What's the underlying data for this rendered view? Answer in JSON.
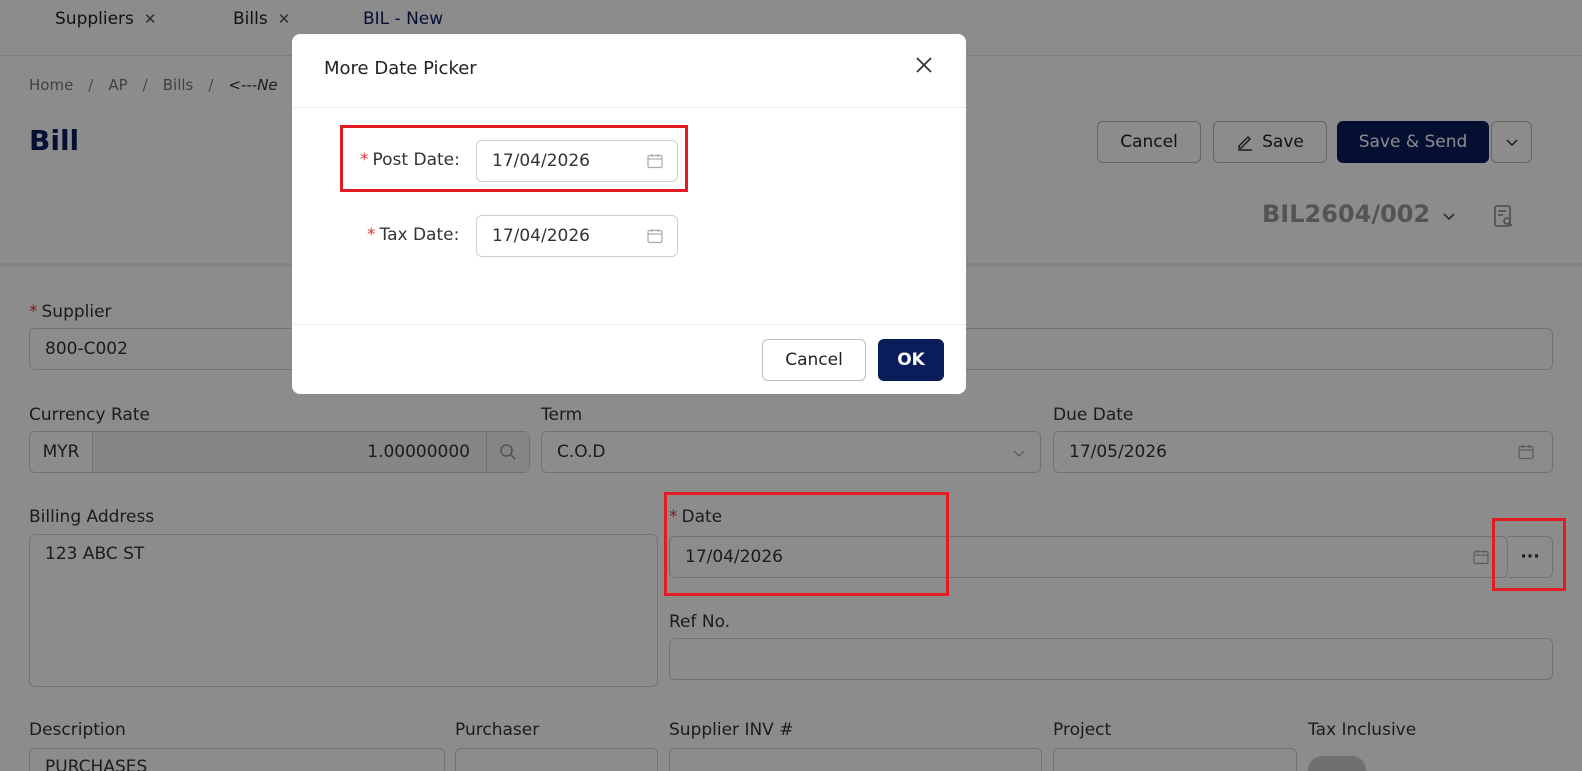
{
  "tabs": [
    {
      "label": "Suppliers",
      "closable": true
    },
    {
      "label": "Bills",
      "closable": true
    },
    {
      "label": "BIL - New",
      "closable": false
    }
  ],
  "breadcrumb": [
    "Home",
    "AP",
    "Bills",
    "<---Ne"
  ],
  "page_title": "Bill",
  "toolbar": {
    "cancel_label": "Cancel",
    "save_label": "Save",
    "save_send_label": "Save & Send"
  },
  "doc_number": "BIL2604/002",
  "form": {
    "supplier_label": "Supplier",
    "supplier_value": "800-C002",
    "currency_rate_label": "Currency Rate",
    "currency_code": "MYR",
    "currency_rate_value": "1.00000000",
    "term_label": "Term",
    "term_value": "C.O.D",
    "due_date_label": "Due Date",
    "due_date_value": "17/05/2026",
    "billing_address_label": "Billing Address",
    "billing_address_value": "123 ABC ST",
    "date_label": "Date",
    "date_value": "17/04/2026",
    "more_label": "···",
    "ref_no_label": "Ref No.",
    "description_label": "Description",
    "description_value": "PURCHASES",
    "purchaser_label": "Purchaser",
    "supplier_inv_label": "Supplier INV #",
    "project_label": "Project",
    "tax_inclusive_label": "Tax Inclusive"
  },
  "modal": {
    "title": "More Date Picker",
    "post_date_label": "Post Date",
    "post_date_value": "17/04/2026",
    "tax_date_label": "Tax Date",
    "tax_date_value": "17/04/2026",
    "cancel_label": "Cancel",
    "ok_label": "OK"
  },
  "colors": {
    "brand": "#0a1d5b",
    "required": "#e0313b",
    "highlight": "#e31b23"
  }
}
